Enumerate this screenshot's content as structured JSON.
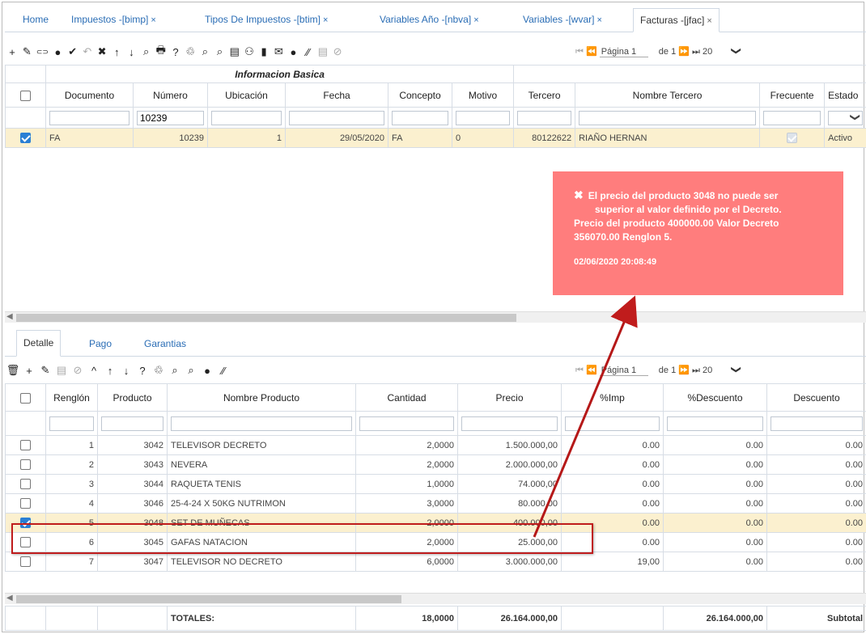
{
  "tabs": [
    {
      "label": "Home",
      "close": ""
    },
    {
      "label": "Impuestos -[bimp]",
      "close": "×"
    },
    {
      "label": "Tipos De Impuestos -[btim]",
      "close": "×"
    },
    {
      "label": "Variables Año -[nbva]",
      "close": "×"
    },
    {
      "label": "Variables -[wvar]",
      "close": "×"
    },
    {
      "label": "Facturas -[jfac]",
      "close": "×"
    }
  ],
  "toolbar_icons": [
    "+",
    "✎",
    "⊂⊃",
    "●",
    "✔",
    "↶",
    "✖",
    "↑",
    "↓",
    "⌕",
    "🖶",
    "?",
    "♲",
    "⌕",
    "⌕",
    "▤",
    "⚇",
    "▮",
    "✉",
    "●",
    "⁄⁄",
    "▤",
    "⊘"
  ],
  "pager": {
    "first": "⏮ ⏪",
    "page_label": "Página 1",
    "of": "de 1",
    "next": "⏩ ⏭",
    "size": "20",
    "dropdown": "❯"
  },
  "header_group": "Informacion Basica",
  "main_columns": [
    "Documento",
    "Número",
    "Ubicación",
    "Fecha",
    "Concepto",
    "Motivo",
    "Tercero",
    "Nombre Tercero",
    "Frecuente",
    "Estado"
  ],
  "main_filter": {
    "numero": "10239",
    "estado": "❯"
  },
  "main_row": {
    "documento": "FA",
    "numero": "10239",
    "ubicacion": "1",
    "fecha": "29/05/2020",
    "concepto": "FA",
    "motivo": "0",
    "tercero": "80122622",
    "nombre": "RIAÑO HERNAN",
    "estado": "Activo"
  },
  "alert": {
    "message_l1": "El precio del producto 3048 no puede ser",
    "message_l2": "superior al valor definido por el Decreto.",
    "message_l3": "Precio del producto 400000.00 Valor Decreto",
    "message_l4": "356070.00 Renglon 5.",
    "timestamp": "02/06/2020 20:08:49",
    "color": "#ff7d7d"
  },
  "subtabs": [
    "Detalle",
    "Pago",
    "Garantias"
  ],
  "detail_toolbar": [
    "🗑",
    "+",
    "✎",
    "▤",
    "⊘",
    "^",
    "↑",
    "↓",
    "?",
    "♲",
    "⌕",
    "⌕",
    "●",
    "⁄⁄"
  ],
  "detail_columns": [
    "Renglón",
    "Producto",
    "Nombre Producto",
    "Cantidad",
    "Precio",
    "%Imp",
    "%Descuento",
    "Descuento"
  ],
  "detail_rows": [
    {
      "renglon": "1",
      "producto": "3042",
      "nombre": "TELEVISOR DECRETO",
      "cantidad": "2,0000",
      "precio": "1.500.000,00",
      "imp": "0.00",
      "pdesc": "0.00",
      "desc": "0.00",
      "checked": false
    },
    {
      "renglon": "2",
      "producto": "3043",
      "nombre": "NEVERA",
      "cantidad": "2,0000",
      "precio": "2.000.000,00",
      "imp": "0.00",
      "pdesc": "0.00",
      "desc": "0.00",
      "checked": false
    },
    {
      "renglon": "3",
      "producto": "3044",
      "nombre": "RAQUETA TENIS",
      "cantidad": "1,0000",
      "precio": "74.000,00",
      "imp": "0.00",
      "pdesc": "0.00",
      "desc": "0.00",
      "checked": false
    },
    {
      "renglon": "4",
      "producto": "3046",
      "nombre": "25-4-24 X 50KG NUTRIMON",
      "cantidad": "3,0000",
      "precio": "80.000,00",
      "imp": "0.00",
      "pdesc": "0.00",
      "desc": "0.00",
      "checked": false
    },
    {
      "renglon": "5",
      "producto": "3048",
      "nombre": "SET DE MUÑECAS",
      "cantidad": "2,0000",
      "precio": "400.000,00",
      "imp": "0.00",
      "pdesc": "0.00",
      "desc": "0.00",
      "checked": true
    },
    {
      "renglon": "6",
      "producto": "3045",
      "nombre": "GAFAS NATACION",
      "cantidad": "2,0000",
      "precio": "25.000,00",
      "imp": "0.00",
      "pdesc": "0.00",
      "desc": "0.00",
      "checked": false
    },
    {
      "renglon": "7",
      "producto": "3047",
      "nombre": "TELEVISOR NO DECRETO",
      "cantidad": "6,0000",
      "precio": "3.000.000,00",
      "imp": "19,00",
      "pdesc": "0.00",
      "desc": "0.00",
      "checked": false
    }
  ],
  "totals": {
    "label": "TOTALES:",
    "cantidad": "18,0000",
    "precio": "26.164.000,00",
    "pdesc": "26.164.000,00",
    "desc": "Subtotal"
  }
}
